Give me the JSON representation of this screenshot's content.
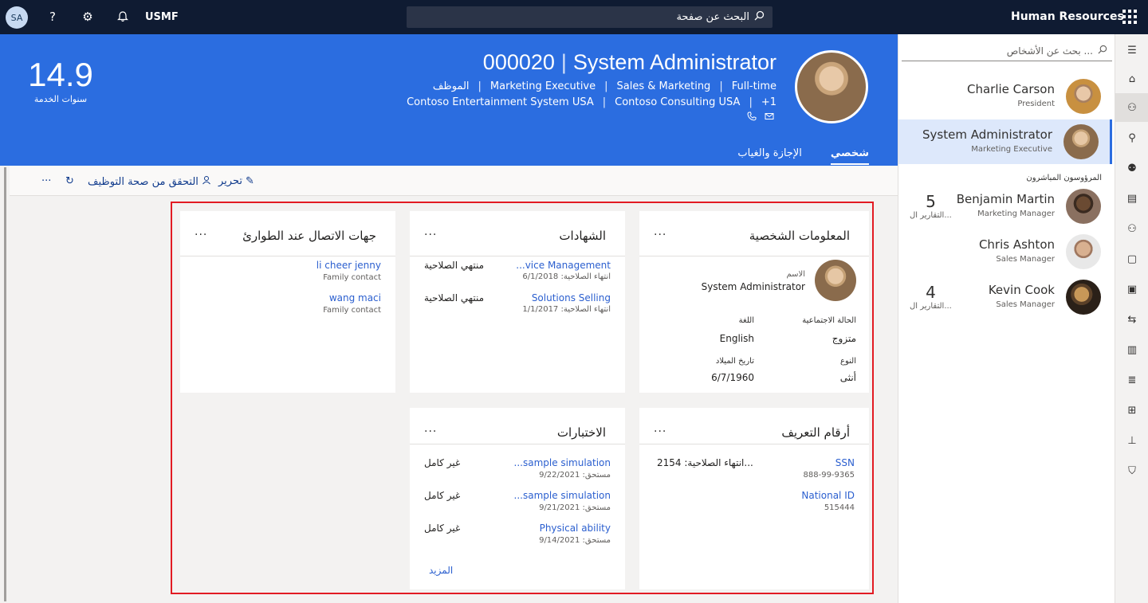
{
  "topbar": {
    "avatar_initials": "SA",
    "help_icon": "?",
    "company": "USMF",
    "search_placeholder": "البحث عن صفحة",
    "app_title": "Human Resources"
  },
  "header": {
    "tenure_value": "14.9",
    "tenure_label": "سنوات الخدمة",
    "employee_id": "000020",
    "employee_name": "System Administrator",
    "line1": [
      "الموظف",
      "Marketing Executive",
      "Sales & Marketing",
      "Full-time"
    ],
    "line2": [
      "Contoso Entertainment System USA",
      "Contoso Consulting USA",
      "+1"
    ],
    "tabs": [
      "شخصي",
      "الإجازة والغياب"
    ]
  },
  "actions": {
    "edit": "تحرير",
    "verify": "التحقق من صحة التوظيف",
    "more": "···"
  },
  "personal": {
    "title": "المعلومات الشخصية",
    "name_label": "الاسم",
    "name_value": "System Administrator",
    "marital_label": "الحالة الاجتماعية",
    "marital_value": "متزوج",
    "language_label": "اللغة",
    "language_value": "English",
    "gender_label": "النوع",
    "gender_value": "أنثى",
    "birth_label": "تاريخ الميلاد",
    "birth_value": "6/7/1960"
  },
  "certificates": {
    "title": "الشهادات",
    "items": [
      {
        "name": "...vice Management",
        "sub": "انتهاء الصلاحية: 6/1/2018",
        "status": "منتهي الصلاحية"
      },
      {
        "name": "Solutions Selling",
        "sub": "انتهاء الصلاحية: 1/1/2017",
        "status": "منتهي الصلاحية"
      }
    ]
  },
  "emergency": {
    "title": "جهات الاتصال عند الطوارئ",
    "items": [
      {
        "name": "li cheer jenny",
        "sub": "Family contact"
      },
      {
        "name": "wang maci",
        "sub": "Family contact"
      }
    ]
  },
  "ids": {
    "title": "أرقام التعريف",
    "items": [
      {
        "name": "SSN",
        "sub": "888-99-9365",
        "status": "انتهاء الصلاحية: 2154..."
      },
      {
        "name": "National ID",
        "sub": "515444",
        "status": ""
      }
    ]
  },
  "tests": {
    "title": "الاختبارات",
    "items": [
      {
        "name": "...sample simulation",
        "sub": "مستحق: 9/22/2021",
        "status": "غير كامل"
      },
      {
        "name": "...sample simulation",
        "sub": "مستحق: 9/21/2021",
        "status": "غير كامل"
      },
      {
        "name": "Physical ability",
        "sub": "مستحق: 9/14/2021",
        "status": "غير كامل"
      }
    ],
    "more_link": "المزيد"
  },
  "card_more": "···",
  "people": {
    "search_placeholder": "بحث عن الأشخاص ...",
    "managers": [
      {
        "name": "Charlie Carson",
        "title": "President"
      },
      {
        "name": "System Administrator",
        "title": "Marketing Executive"
      }
    ],
    "directs_label": "المرؤوسون المباشرون",
    "directs": [
      {
        "name": "Benjamin Martin",
        "title": "Marketing Manager",
        "count": "5",
        "count_label": "التقارير ال..."
      },
      {
        "name": "Chris Ashton",
        "title": "Sales Manager",
        "count": "",
        "count_label": ""
      },
      {
        "name": "Kevin Cook",
        "title": "Sales Manager",
        "count": "4",
        "count_label": "التقارير ال..."
      }
    ]
  },
  "colors": {
    "header_blue": "#2b6de0",
    "topbar": "#0f1b32",
    "link": "#2b5fcf",
    "highlight_border": "#e21b23"
  }
}
